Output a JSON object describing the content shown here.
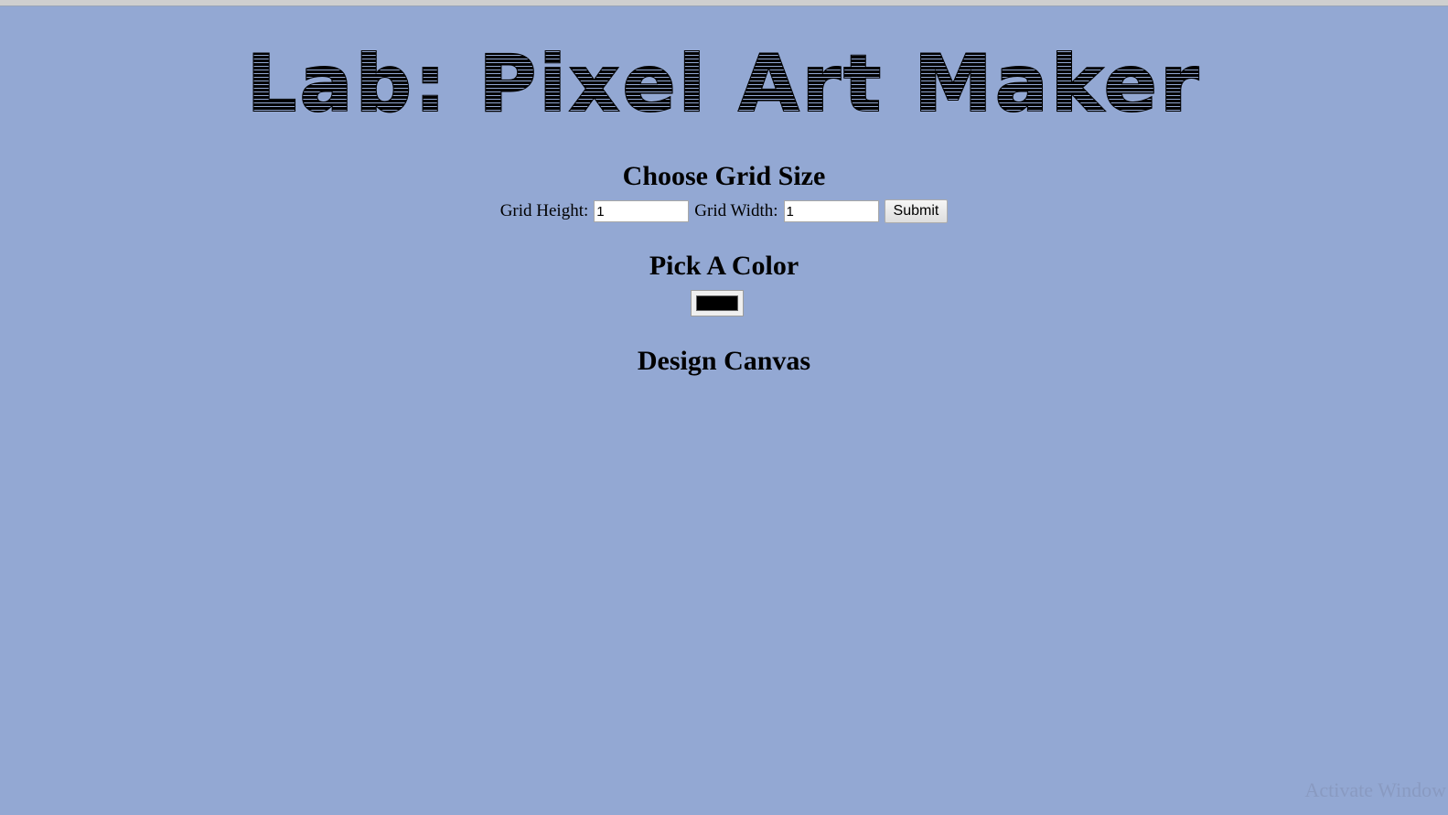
{
  "page": {
    "title": "Lab: Pixel Art Maker"
  },
  "grid_section": {
    "heading": "Choose Grid Size",
    "height_label": "Grid Height:",
    "height_value": "1",
    "width_label": "Grid Width:",
    "width_value": "1",
    "submit_label": "Submit"
  },
  "color_section": {
    "heading": "Pick A Color",
    "selected_color": "#000000"
  },
  "canvas_section": {
    "heading": "Design Canvas"
  },
  "watermark": {
    "text": "Activate Window"
  },
  "colors": {
    "background": "#93a8d3"
  }
}
